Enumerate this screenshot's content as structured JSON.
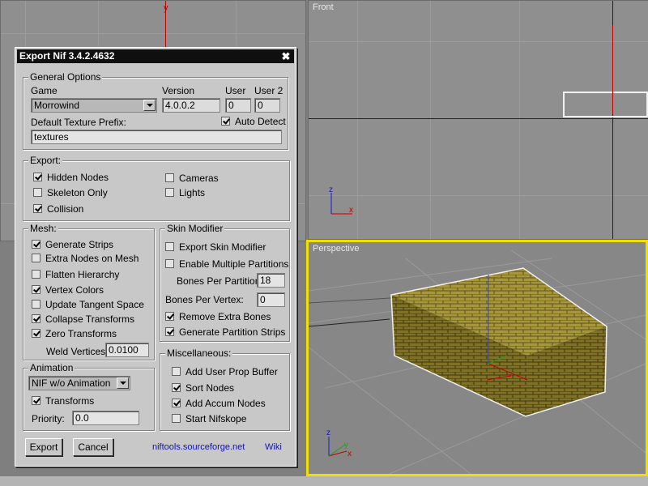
{
  "viewports": {
    "top_axis_label": "y",
    "front_label": "Front",
    "perspective_label": "Perspective",
    "axis_x": "x",
    "axis_y": "y",
    "axis_z": "z"
  },
  "dialog": {
    "title": "Export Nif 3.4.2.4632",
    "general": {
      "label": "General Options",
      "game_label": "Game",
      "game_value": "Morrowind",
      "version_label": "Version",
      "version_value": "4.0.0.2",
      "user_label": "User",
      "user_value": "0",
      "user2_label": "User 2",
      "user2_value": "0",
      "auto_detect": "Auto Detect",
      "texture_prefix_label": "Default Texture Prefix:",
      "texture_prefix_value": "textures"
    },
    "export": {
      "label": "Export:",
      "hidden_nodes": "Hidden Nodes",
      "skeleton_only": "Skeleton Only",
      "collision": "Collision",
      "cameras": "Cameras",
      "lights": "Lights"
    },
    "mesh": {
      "label": "Mesh:",
      "generate_strips": "Generate Strips",
      "extra_nodes": "Extra Nodes on Mesh",
      "flatten_hierarchy": "Flatten Hierarchy",
      "vertex_colors": "Vertex Colors",
      "update_tangent": "Update Tangent Space",
      "collapse_transforms": "Collapse Transforms",
      "zero_transforms": "Zero Transforms",
      "weld_label": "Weld Vertices:",
      "weld_value": "0.0100"
    },
    "skin": {
      "label": "Skin Modifier",
      "export_skin": "Export Skin Modifier",
      "multiple_partitions": "Enable Multiple Partitions",
      "bones_partition_label": "Bones Per Partition:",
      "bones_partition_value": "18",
      "bones_vertex_label": "Bones Per Vertex:",
      "bones_vertex_value": "0",
      "remove_extra": "Remove Extra Bones",
      "generate_partition_strips": "Generate Partition Strips"
    },
    "animation": {
      "label": "Animation",
      "mode_value": "NIF w/o Animation",
      "transforms": "Transforms",
      "priority_label": "Priority:",
      "priority_value": "0.0"
    },
    "misc": {
      "label": "Miscellaneous:",
      "user_prop": "Add User Prop Buffer",
      "sort_nodes": "Sort Nodes",
      "accum_nodes": "Add Accum Nodes",
      "start_nifskope": "Start Nifskope"
    },
    "footer": {
      "export_btn": "Export",
      "cancel_btn": "Cancel",
      "site_link": "niftools.sourceforge.net",
      "wiki_link": "Wiki"
    }
  }
}
